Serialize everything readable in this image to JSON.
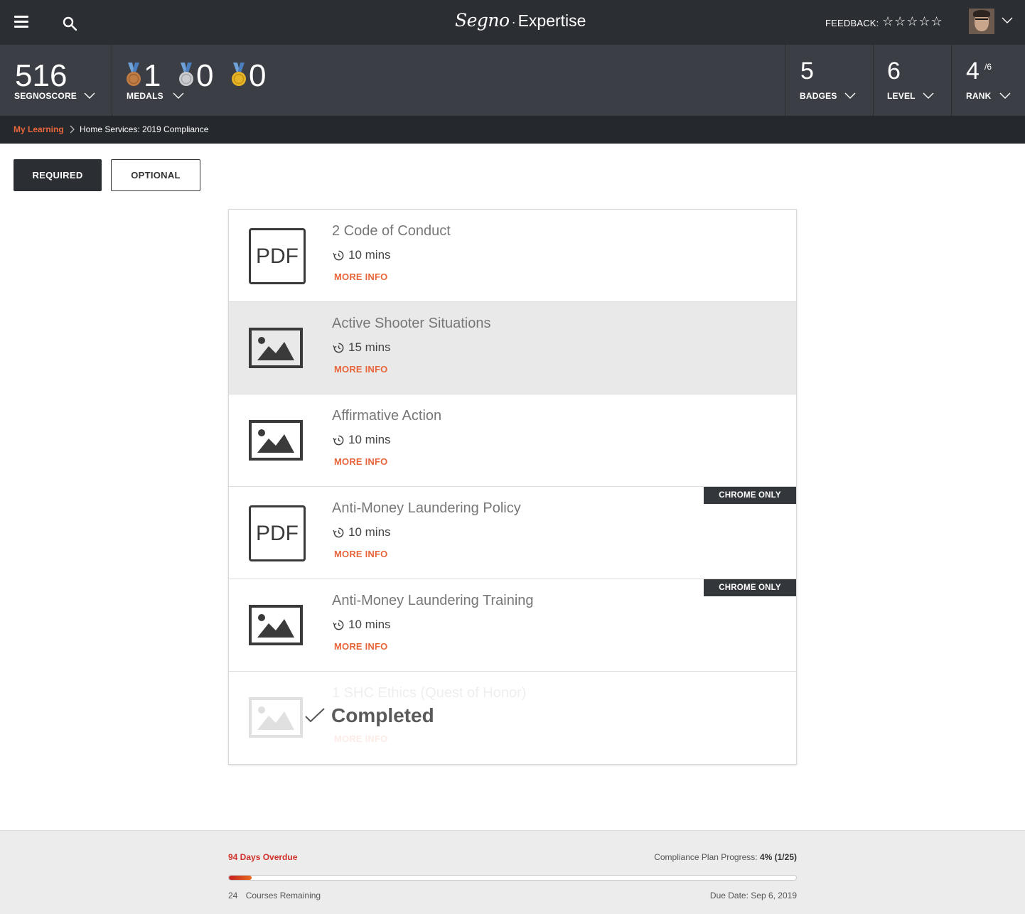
{
  "header": {
    "logo_script": "Segno",
    "logo_separator": "·",
    "logo_word": "Expertise",
    "feedback_label": "FEEDBACK:",
    "stars": "☆☆☆☆☆"
  },
  "stats": {
    "segnoscore": {
      "value": "516",
      "label": "SEGNOSCORE"
    },
    "medals": {
      "label": "MEDALS",
      "bronze": "1",
      "silver": "0",
      "gold": "0"
    },
    "badges": {
      "value": "5",
      "label": "BADGES"
    },
    "level": {
      "value": "6",
      "label": "LEVEL"
    },
    "rank": {
      "value": "4",
      "of": "/6",
      "label": "RANK"
    }
  },
  "breadcrumb": {
    "root": "My Learning",
    "separator": ">",
    "current": "Home Services: 2019 Compliance"
  },
  "tabs": {
    "required": "REQUIRED",
    "optional": "OPTIONAL"
  },
  "courses": [
    {
      "title": "2 Code of Conduct",
      "type": "PDF",
      "duration": "10 mins",
      "more_info": "MORE INFO",
      "badge": ""
    },
    {
      "title": "Active Shooter Situations",
      "type": "image",
      "duration": "15 mins",
      "more_info": "MORE INFO",
      "badge": ""
    },
    {
      "title": "Affirmative Action",
      "type": "image",
      "duration": "10 mins",
      "more_info": "MORE INFO",
      "badge": ""
    },
    {
      "title": "Anti-Money Laundering Policy",
      "type": "PDF",
      "duration": "10 mins",
      "more_info": "MORE INFO",
      "badge": "CHROME ONLY"
    },
    {
      "title": "Anti-Money Laundering Training",
      "type": "image",
      "duration": "10 mins",
      "more_info": "MORE INFO",
      "badge": "CHROME ONLY"
    },
    {
      "title": "1 SHC Ethics (Quest of Honor)",
      "type": "image",
      "duration": "",
      "more_info": "MORE INFO",
      "badge": "",
      "status": "Completed"
    }
  ],
  "footer": {
    "overdue": "94 Days Overdue",
    "progress_label": "Compliance Plan Progress:",
    "progress_percent": "4%",
    "progress_count": "(1/25)",
    "progress_fraction": 0.04,
    "remaining_count": "24",
    "remaining_label": "Courses Remaining",
    "due_date": "Due Date: Sep 6, 2019"
  },
  "colors": {
    "accent": "#e8663c",
    "overdue": "#d0302b",
    "topbar": "#2b2e33",
    "statsbar": "#3b3f45"
  }
}
